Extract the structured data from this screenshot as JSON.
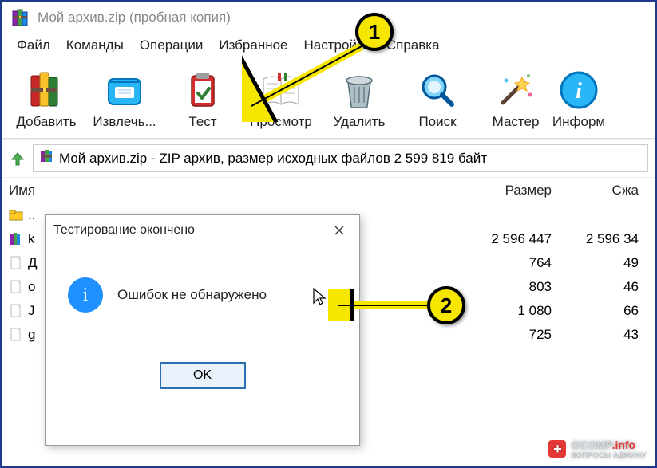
{
  "title": "Мой архив.zip (пробная копия)",
  "menu": [
    "Файл",
    "Команды",
    "Операции",
    "Избранное",
    "Настройки",
    "Справка"
  ],
  "toolbar": [
    {
      "label": "Добавить"
    },
    {
      "label": "Извлечь..."
    },
    {
      "label": "Тест"
    },
    {
      "label": "Просмотр"
    },
    {
      "label": "Удалить"
    },
    {
      "label": "Поиск"
    },
    {
      "label": "Мастер"
    },
    {
      "label": "Информ"
    }
  ],
  "pathbar": "Мой архив.zip - ZIP архив, размер исходных файлов 2 599 819 байт",
  "columns": {
    "name": "Имя",
    "size": "Размер",
    "packed": "Сжа"
  },
  "rows": [
    {
      "name": "..",
      "size": "",
      "packed": ""
    },
    {
      "name": "k",
      "size": "2 596 447",
      "packed": "2 596 34"
    },
    {
      "name": "Д",
      "size": "764",
      "packed": "49"
    },
    {
      "name": "о",
      "size": "803",
      "packed": "46"
    },
    {
      "name": "J",
      "size": "1 080",
      "packed": "66"
    },
    {
      "name": "g",
      "size": "725",
      "packed": "43"
    }
  ],
  "dialog": {
    "title": "Тестирование окончено",
    "message": "Ошибок не обнаружено",
    "ok": "OK"
  },
  "markers": {
    "m1": "1",
    "m2": "2"
  },
  "watermark": {
    "main": "OCOMP",
    "suffix": ".info",
    "sub": "ВОПРОСЫ АДМИНУ"
  }
}
